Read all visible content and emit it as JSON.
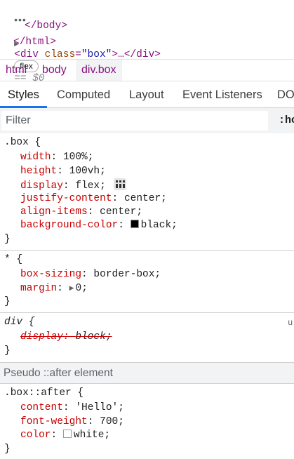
{
  "dom_tree": {
    "more_glyph": "•••",
    "expand_glyph": "▶",
    "open_tag_start": "<div",
    "attr_name": "class",
    "attr_eq": "=",
    "attr_value": "\"box\"",
    "open_tag_end": ">…</div>",
    "badge": "flex",
    "selected_marker": "== $0",
    "body_close": "</body>",
    "html_close": "</html>"
  },
  "breadcrumb": {
    "items": [
      {
        "label": "html",
        "selected": false
      },
      {
        "label": "body",
        "selected": false
      },
      {
        "label": "div.box",
        "selected": true
      }
    ]
  },
  "tabs": [
    {
      "label": "Styles",
      "active": true
    },
    {
      "label": "Computed",
      "active": false
    },
    {
      "label": "Layout",
      "active": false
    },
    {
      "label": "Event Listeners",
      "active": false
    },
    {
      "label": "DO",
      "active": false
    }
  ],
  "filter": {
    "placeholder": "Filter",
    "hov_label": ":ho"
  },
  "rules": {
    "box": {
      "selector": ".box {",
      "close": "}",
      "declarations": [
        {
          "prop": "width",
          "value": "100%;"
        },
        {
          "prop": "height",
          "value": "100vh;"
        },
        {
          "prop": "display",
          "value": "flex;"
        },
        {
          "prop": "justify-content",
          "value": "center;"
        },
        {
          "prop": "align-items",
          "value": "center;"
        },
        {
          "prop": "background-color",
          "value": "black;",
          "swatch": "#000000"
        }
      ]
    },
    "universal": {
      "selector": "* {",
      "close": "}",
      "declarations": [
        {
          "prop": "box-sizing",
          "value": "border-box;"
        },
        {
          "prop": "margin",
          "value": "0;"
        }
      ]
    },
    "div": {
      "selector": "div {",
      "close": "}",
      "source": "u",
      "declarations": [
        {
          "prop": "display",
          "value": "block;",
          "overridden": true
        }
      ]
    },
    "pseudo_header": "Pseudo ::after element",
    "after": {
      "selector": ".box::after {",
      "close": "}",
      "declarations": [
        {
          "prop": "content",
          "value": "'Hello';"
        },
        {
          "prop": "font-weight",
          "value": "700;"
        },
        {
          "prop": "color",
          "value": "white;",
          "swatch": "#ffffff"
        }
      ]
    }
  },
  "colors": {
    "tag": "#881280",
    "property": "#c80000",
    "accent": "#1a73e8"
  }
}
